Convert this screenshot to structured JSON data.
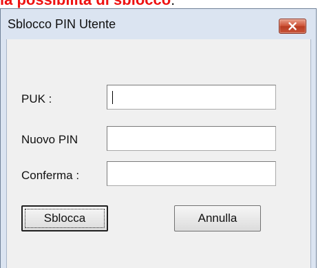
{
  "background": {
    "heading_text": "la possibilità di sblocco",
    "heading_tail": ":"
  },
  "dialog": {
    "title": "Sblocco PIN Utente",
    "close_icon": "close-x-icon",
    "fields": [
      {
        "label": "PUK :",
        "value": ""
      },
      {
        "label": "Nuovo PIN",
        "value": ""
      },
      {
        "label": "Conferma :",
        "value": ""
      }
    ],
    "buttons": {
      "unlock_label": "Sblocca",
      "cancel_label": "Annulla"
    }
  },
  "colors": {
    "heading_red": "#ee1111",
    "window_frame": "#dbe4f1",
    "client_bg": "#f0f0f0",
    "close_red": "#c8553a"
  }
}
